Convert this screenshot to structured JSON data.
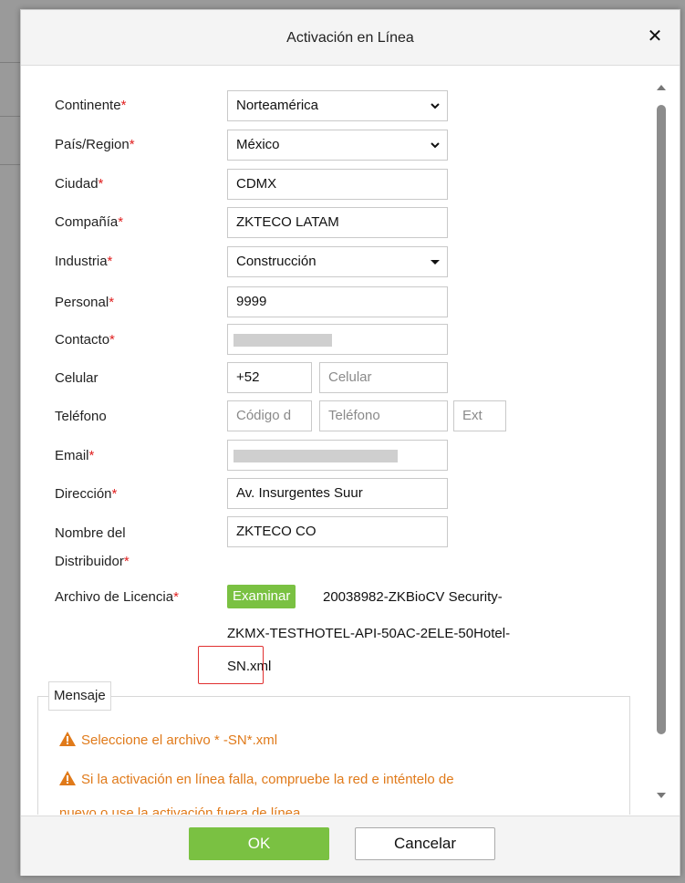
{
  "dialog": {
    "title": "Activación en Línea"
  },
  "form": {
    "continente": {
      "label": "Continente",
      "value": "Norteamérica"
    },
    "pais": {
      "label": "País/Region",
      "value": "México"
    },
    "ciudad": {
      "label": "Ciudad",
      "value": "CDMX"
    },
    "compania": {
      "label": "Compañía",
      "value": "ZKTECO LATAM"
    },
    "industria": {
      "label": "Industria",
      "value": "Construcción"
    },
    "personal": {
      "label": "Personal",
      "value": "9999"
    },
    "contacto": {
      "label": "Contacto"
    },
    "celular": {
      "label": "Celular",
      "code": "+52",
      "placeholder": "Celular"
    },
    "telefono": {
      "label": "Teléfono",
      "code_placeholder": "Código d",
      "placeholder": "Teléfono",
      "ext_placeholder": "Ext"
    },
    "email": {
      "label": "Email"
    },
    "direccion": {
      "label": "Dirección",
      "value": "Av. Insurgentes Suur"
    },
    "distribuidor": {
      "label_line1": "Nombre del",
      "label_line2": "Distribuidor",
      "value": "ZKTECO CO"
    },
    "licencia": {
      "label": "Archivo de Licencia",
      "button": "Examinar",
      "file_line1": "20038982-ZKBioCV Security-",
      "file_line2": "ZKMX-TESTHOTEL-API-50AC-2ELE-50Hotel-",
      "file_line3": "SN.xml"
    },
    "required_mark": "*"
  },
  "mensaje": {
    "legend": "Mensaje",
    "warnings": [
      "Seleccione el archivo * -SN*.xml",
      "Si la activación en línea falla, compruebe la red e inténtelo de",
      "nuevo o use la activación fuera de línea"
    ]
  },
  "footer": {
    "ok": "OK",
    "cancel": "Cancelar"
  },
  "colors": {
    "accent_green": "#7ac142",
    "required_red": "#e02020",
    "warning_orange": "#e07a1a"
  }
}
